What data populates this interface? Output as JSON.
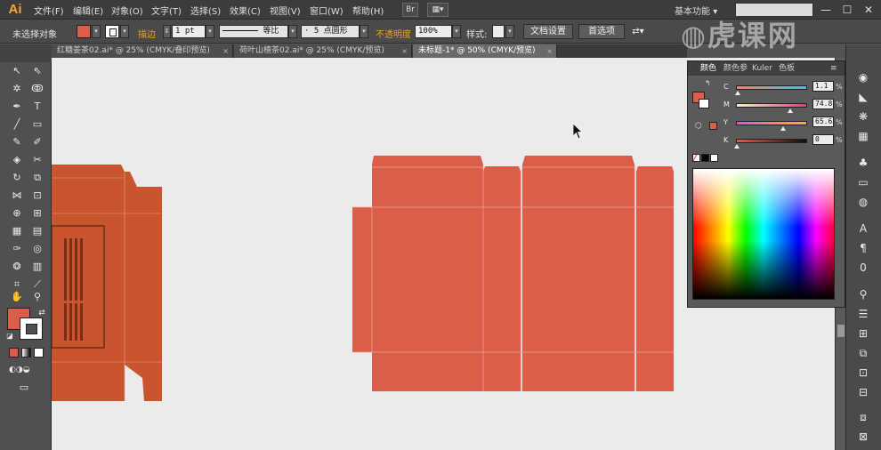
{
  "app": {
    "logo": "Ai"
  },
  "menu": {
    "items": [
      "文件(F)",
      "编辑(E)",
      "对象(O)",
      "文字(T)",
      "选择(S)",
      "效果(C)",
      "视图(V)",
      "窗口(W)",
      "帮助(H)"
    ],
    "bridge_label": "Br",
    "workspace": "基本功能",
    "workspace_arrow": "▾"
  },
  "control_bar": {
    "selection_status": "未选择对象",
    "stroke_label": "描边",
    "stroke_weight": "1 pt",
    "stroke_profile": "等比",
    "brush": "5 点圆形",
    "opacity_label": "不透明度",
    "opacity_value": "100%",
    "style_label": "样式:",
    "doc_setup_button": "文档设置",
    "preferences_button": "首选项",
    "fill_color": "#db5e4b"
  },
  "tabs": [
    {
      "label": "红糖姜茶02.ai* @ 25% (CMYK/叠印预览)",
      "active": false
    },
    {
      "label": "荷叶山楂茶02.ai* @ 25% (CMYK/预览)",
      "active": false
    },
    {
      "label": "未标题-1* @ 50% (CMYK/预览)",
      "active": true
    }
  ],
  "tab_close_glyph": "×",
  "color_panel": {
    "tabs": [
      "颜色",
      "颜色参",
      "Kuler",
      "色板"
    ],
    "channels": [
      {
        "label": "C",
        "value": "1.1",
        "unit": "%",
        "position": 0.011
      },
      {
        "label": "M",
        "value": "74.82",
        "unit": "%",
        "position": 0.748
      },
      {
        "label": "Y",
        "value": "65.63",
        "unit": "%",
        "position": 0.656
      },
      {
        "label": "K",
        "value": "0",
        "unit": "%",
        "position": 0.0
      }
    ],
    "fill_color": "#db5e4b"
  },
  "watermark": "虎课网",
  "window_controls": {
    "minimize": "—",
    "maximize": "☐",
    "close": "✕"
  },
  "colors": {
    "box_red": "#db5e4b",
    "box_dark": "#c9552e",
    "canvas": "#ebebeb"
  }
}
